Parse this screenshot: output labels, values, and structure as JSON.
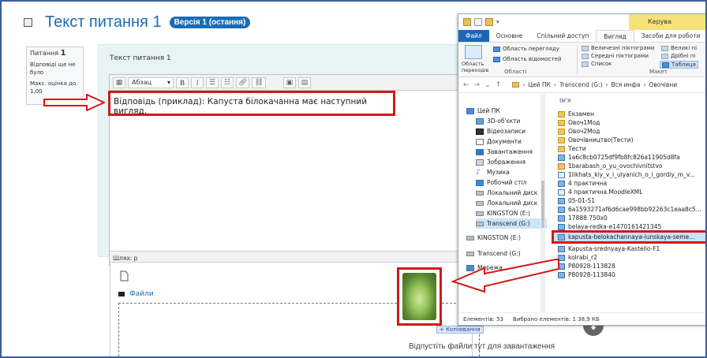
{
  "question": {
    "title": "Текст питання 1",
    "version_badge": "Версія 1 (остання)",
    "info": {
      "label": "Питання",
      "number": "1",
      "status": "Відповіді ще не було",
      "max_grade": "Макс. оцінка до 1,00"
    },
    "question_text": "Текст питання 1",
    "editor": {
      "format_select": "Абзац",
      "bold": "B",
      "italic": "I",
      "answer_text": "Відповідь (приклад): Капуста білокачанна має наступний вигляд.",
      "path": "Шлях: p"
    },
    "files": {
      "label": "Файли",
      "drop_hint": "Відпустіть файли тут для завантаження",
      "copy_badge": "+ Копіювання"
    }
  },
  "explorer": {
    "titlebar_tail": "Керува",
    "tabs": [
      "Файл",
      "Основне",
      "Спільний доступ",
      "Вигляд",
      "Засоби для роботи"
    ],
    "ribbon": {
      "preview_pane": "Область перегляду",
      "details_pane": "Область відомостей",
      "nav_pane": "Область переходів",
      "large_icons": "Величезні піктограми",
      "big_icons": "Великі пі",
      "medium_icons": "Середні піктограми",
      "small_icons": "Дрібні пі",
      "list": "Список",
      "table": "Таблиця",
      "group_panes": "Області",
      "group_layout": "Макет"
    },
    "address": [
      "Цей ПК",
      "Transcend (G:)",
      "Вся инфа",
      "Овочівни"
    ],
    "nav_items": [
      "Цей ПК",
      "3D-об'єкти",
      "Відеозаписи",
      "Документи",
      "Завантаження",
      "Зображення",
      "Музика",
      "Робочий стіл",
      "Локальний диск",
      "Локальний диск",
      "KINGSTON (E:)",
      "Transcend (G:)",
      "KINGSTON (E:)",
      "Transcend (G:)",
      "Мережа"
    ],
    "column_header": "Ім'я",
    "files": [
      {
        "name": "Екзамен",
        "kind": "folder"
      },
      {
        "name": "Овоч1Мод",
        "kind": "folder"
      },
      {
        "name": "Овоч2Мод",
        "kind": "folder"
      },
      {
        "name": "Овочівництво(Тести)",
        "kind": "folder"
      },
      {
        "name": "Тести",
        "kind": "folder"
      },
      {
        "name": "1a6c8cb0725df9fb8fc826a11905d8fa",
        "kind": "img"
      },
      {
        "name": "1barabash_o_yu_ovochivnitstvo",
        "kind": "pdf"
      },
      {
        "name": "1likhats_kiy_v_i_ulyanich_o_i_gordiy_m_v...",
        "kind": "doc"
      },
      {
        "name": "4 практична",
        "kind": "img"
      },
      {
        "name": "4 практична.MoodleXML",
        "kind": "doc"
      },
      {
        "name": "05-01-51",
        "kind": "img"
      },
      {
        "name": "6a1593271af6d6cae998bb92263c1eaa8c5...",
        "kind": "img"
      },
      {
        "name": "17888.750x0",
        "kind": "img"
      },
      {
        "name": "belaya-redka-e1470161421345",
        "kind": "img"
      },
      {
        "name": "kapusta-belokachannaya-iunskaya-seme...",
        "kind": "img"
      },
      {
        "name": "Kapusta-srednyaya-Kastello-F1",
        "kind": "img"
      },
      {
        "name": "kolrabi_r2",
        "kind": "img"
      },
      {
        "name": "P80928-113828",
        "kind": "img"
      },
      {
        "name": "P80928-113840",
        "kind": "img"
      }
    ],
    "status": {
      "count": "Елементів: 53",
      "selected": "Вибрано елементів: 1  38,9 КБ"
    }
  },
  "colors": {
    "accent_blue": "#1a6db5",
    "highlight_red": "#d11a1a",
    "editor_bg": "#e7f3f5"
  }
}
